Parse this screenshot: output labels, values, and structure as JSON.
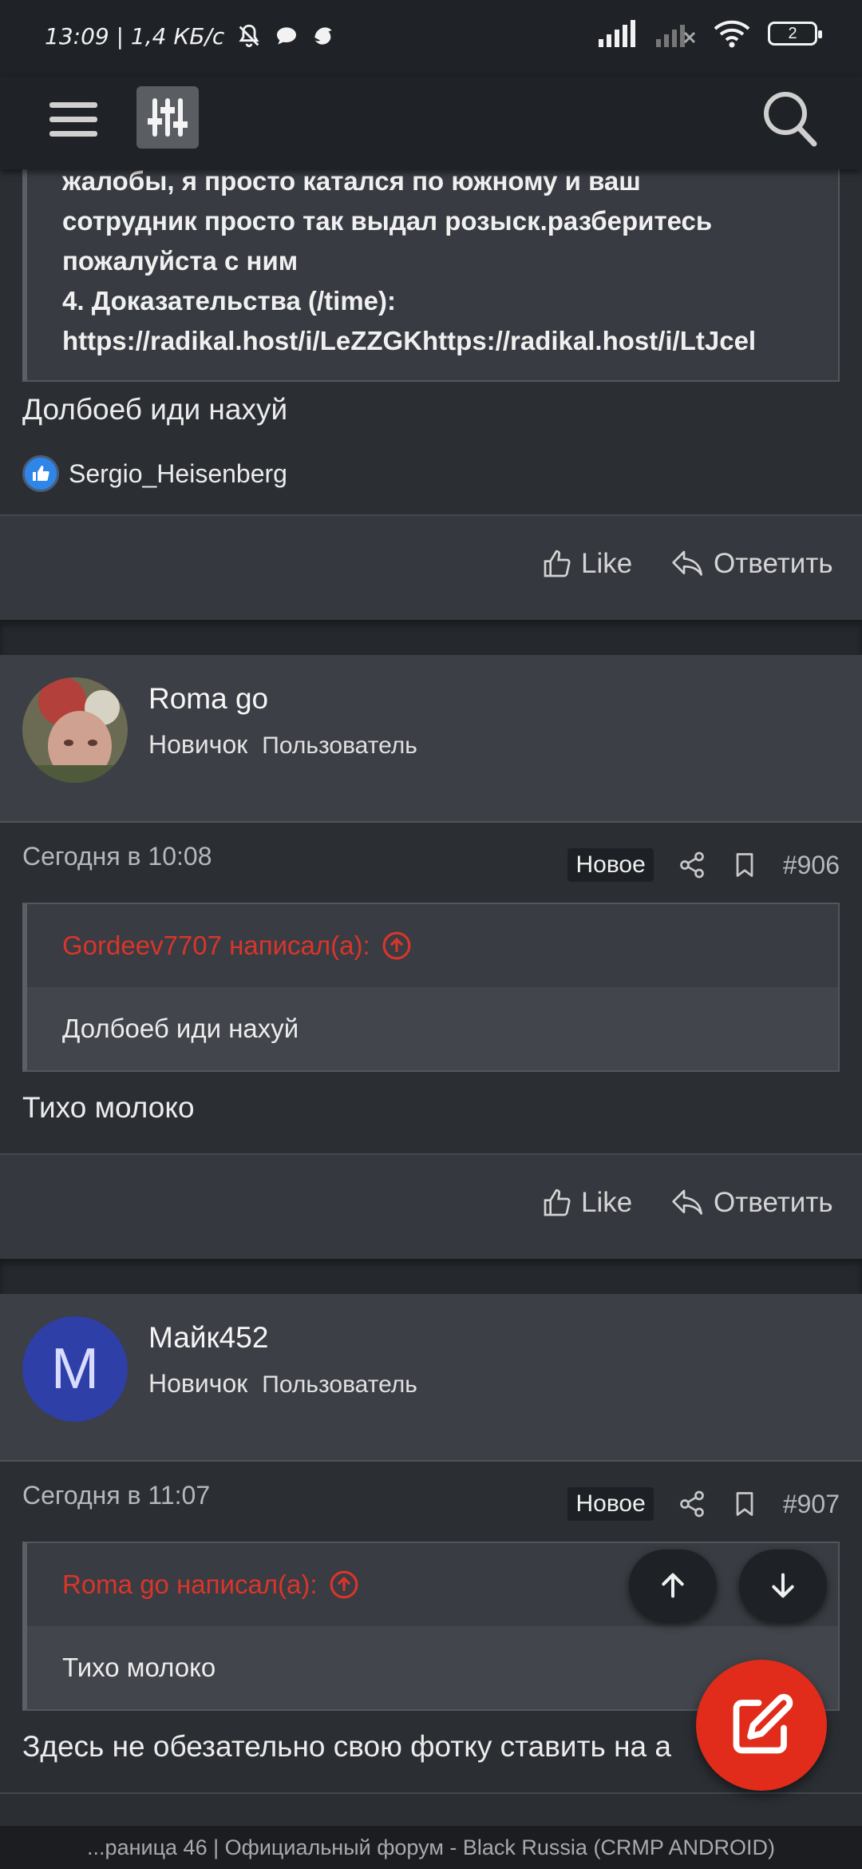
{
  "status_bar": {
    "time_speed": "13:09 | 1,4 КБ/с",
    "battery": "2"
  },
  "post1": {
    "quote_lines": [
      "жалобы, я просто катался по южному и ваш",
      "сотрудник просто так выдал розыск.разберитесь",
      "пожалуйста с ним",
      "4. Доказательства (/time):",
      "https://radikal.host/i/LeZZGKhttps://radikal.host/i/LtJcel"
    ],
    "text": "Долбоеб иди нахуй",
    "reaction_user": "Sergio_Heisenberg",
    "like_label": "Like",
    "reply_label": "Ответить"
  },
  "post2": {
    "author": "Roma go",
    "rank": "Новичок",
    "role": "Пользователь",
    "date": "Сегодня в 10:08",
    "badge": "Новое",
    "number": "#906",
    "quote_author": "Gordeev7707 написал(а):",
    "quote_text": "Долбоеб иди нахуй",
    "text": "Тихо молоко",
    "like_label": "Like",
    "reply_label": "Ответить"
  },
  "post3": {
    "author": "Майк452",
    "avatar_letter": "M",
    "rank": "Новичок",
    "role": "Пользователь",
    "date": "Сегодня в 11:07",
    "badge": "Новое",
    "number": "#907",
    "quote_author": "Roma go написал(а):",
    "quote_text": "Тихо молоко",
    "text": "Здесь не обезательно свою фотку ставить на а"
  },
  "bottom_title": "...раница 46 | Официальный форум - Black Russia (CRMP ANDROID)",
  "colors": {
    "accent_red": "#e12c1b",
    "quote_red": "#d9352b",
    "avatar_blue": "#2e3fa8"
  }
}
